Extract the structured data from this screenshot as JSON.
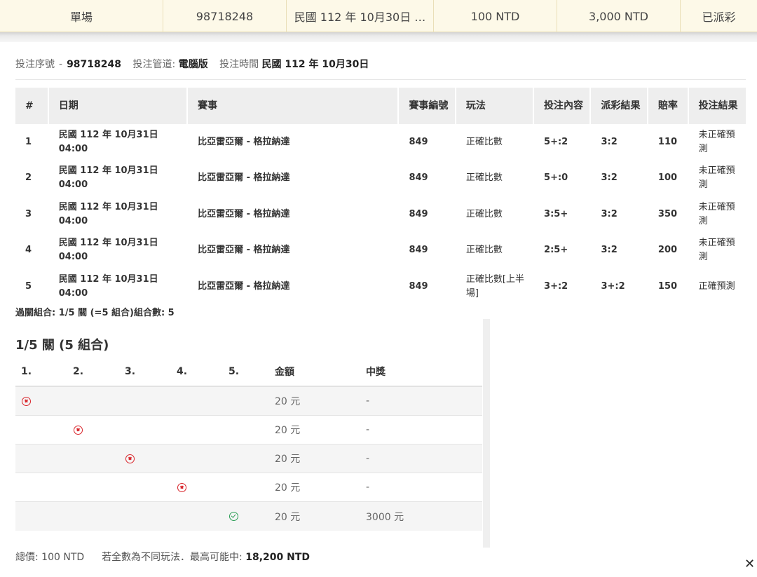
{
  "summary": {
    "cells": [
      "單場",
      "98718248",
      "民國 112 年 10月30日 …",
      "100 NTD",
      "3,000 NTD",
      "已派彩"
    ]
  },
  "info": {
    "serial_label": "投注序號",
    "serial_sep": "-",
    "serial_value": "98718248",
    "channel_label": "投注管道:",
    "channel_value": "電腦版",
    "time_label": "投注時間",
    "time_value": "民國 112 年 10月30日"
  },
  "bets": {
    "headers": [
      "#",
      "日期",
      "賽事",
      "賽事編號",
      "玩法",
      "投注內容",
      "派彩結果",
      "賠率",
      "投注結果"
    ],
    "rows": [
      {
        "no": "1",
        "date": "民國 112 年 10月31日",
        "time": "04:00",
        "match": "比亞雷亞爾 - 格拉納達",
        "match_no": "849",
        "play": "正確比數",
        "pick": "5+:2",
        "result": "3:2",
        "odds": "110",
        "outcome": "未正確預測"
      },
      {
        "no": "2",
        "date": "民國 112 年 10月31日",
        "time": "04:00",
        "match": "比亞雷亞爾 - 格拉納達",
        "match_no": "849",
        "play": "正確比數",
        "pick": "5+:0",
        "result": "3:2",
        "odds": "100",
        "outcome": "未正確預測"
      },
      {
        "no": "3",
        "date": "民國 112 年 10月31日",
        "time": "04:00",
        "match": "比亞雷亞爾 - 格拉納達",
        "match_no": "849",
        "play": "正確比數",
        "pick": "3:5+",
        "result": "3:2",
        "odds": "350",
        "outcome": "未正確預測"
      },
      {
        "no": "4",
        "date": "民國 112 年 10月31日",
        "time": "04:00",
        "match": "比亞雷亞爾 - 格拉納達",
        "match_no": "849",
        "play": "正確比數",
        "pick": "2:5+",
        "result": "3:2",
        "odds": "200",
        "outcome": "未正確預測"
      },
      {
        "no": "5",
        "date": "民國 112 年 10月31日",
        "time": "04:00",
        "match": "比亞雷亞爾 - 格拉納達",
        "match_no": "849",
        "play": "正確比數[上半場]",
        "pick": "3+:2",
        "result": "3+:2",
        "odds": "150",
        "outcome": "正確預測"
      }
    ]
  },
  "combo_summary": "過關組合: 1/5 關 (=5 組合)組合數: 5",
  "combo": {
    "title": "1/5 關 (5 組合)",
    "headers": [
      "1.",
      "2.",
      "3.",
      "4.",
      "5.",
      "金額",
      "中獎"
    ],
    "rows": [
      {
        "col": 1,
        "status": "lose",
        "amount": "20 元",
        "prize": "-"
      },
      {
        "col": 2,
        "status": "lose",
        "amount": "20 元",
        "prize": "-"
      },
      {
        "col": 3,
        "status": "lose",
        "amount": "20 元",
        "prize": "-"
      },
      {
        "col": 4,
        "status": "lose",
        "amount": "20 元",
        "prize": "-"
      },
      {
        "col": 5,
        "status": "win",
        "amount": "20 元",
        "prize": "3000 元"
      }
    ]
  },
  "footer": {
    "total_label": "總價:",
    "total_value": "100 NTD",
    "max_label": "若全數為不同玩法．最高可能中:",
    "max_value": "18,200 NTD"
  },
  "close_glyph": "✕",
  "icons": {
    "lose": "circle-x-icon",
    "win": "circle-check-icon"
  },
  "colors": {
    "summary_bg": "#fdf9e8",
    "lose": "#d9262c",
    "win": "#2a9d54"
  }
}
